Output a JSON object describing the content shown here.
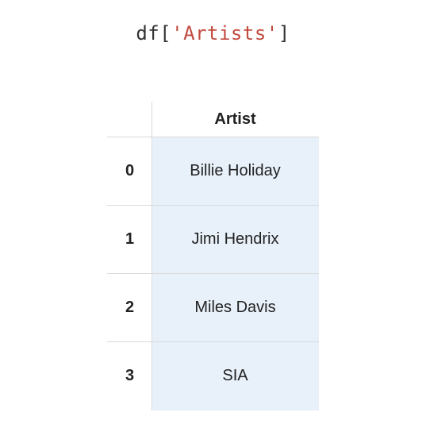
{
  "code": {
    "prefix": "df[",
    "string": "'Artists'",
    "suffix": "]"
  },
  "table": {
    "column_header": "Artist",
    "rows": [
      {
        "index": "0",
        "value": "Billie Holiday"
      },
      {
        "index": "1",
        "value": "Jimi Hendrix"
      },
      {
        "index": "2",
        "value": "Miles Davis"
      },
      {
        "index": "3",
        "value": "SIA"
      }
    ]
  }
}
